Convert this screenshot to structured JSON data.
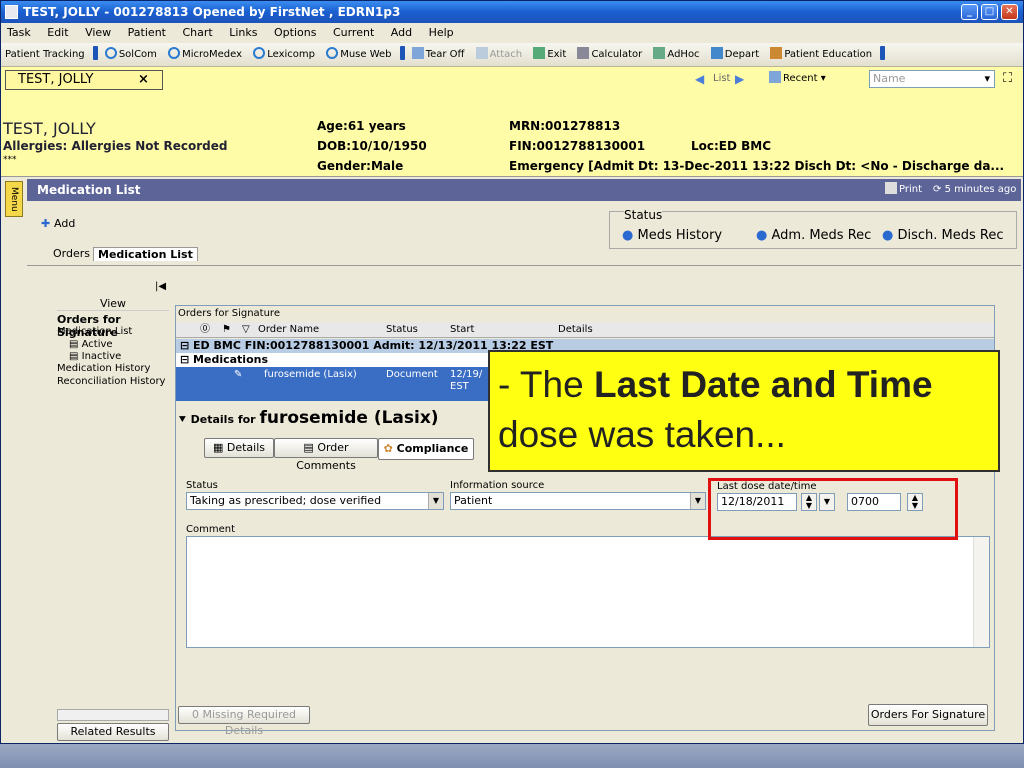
{
  "window": {
    "title": "TEST, JOLLY - 001278813 Opened by FirstNet , EDRN1p3"
  },
  "menu": [
    "Task",
    "Edit",
    "View",
    "Patient",
    "Chart",
    "Links",
    "Options",
    "Current",
    "Add",
    "Help"
  ],
  "toolbar": [
    "Patient Tracking",
    "SolCom",
    "MicroMedex",
    "Lexicomp",
    "Muse Web",
    "Tear Off",
    "Attach",
    "Exit",
    "Calculator",
    "AdHoc",
    "Depart",
    "Patient Education"
  ],
  "patient_tab": {
    "label": "TEST, JOLLY",
    "close": "×"
  },
  "nav": {
    "list": "List",
    "recent": "Recent",
    "name_placeholder": "Name"
  },
  "demographics": {
    "name": "TEST, JOLLY",
    "allergies": "Allergies: Allergies Not Recorded",
    "stars": "***",
    "age": "Age:61 years",
    "dob": "DOB:10/10/1950",
    "gender": "Gender:Male",
    "mrn": "MRN:001278813",
    "fin": "FIN:0012788130001",
    "loc": "Loc:ED BMC",
    "encounter": "Emergency  [Admit Dt: 13-Dec-2011 13:22  Disch Dt: <No - Discharge da..."
  },
  "section": {
    "title": "Medication List",
    "print": "Print",
    "refreshed": "5 minutes ago",
    "menu_tab": "Menu"
  },
  "status_box": {
    "label": "Status",
    "items": [
      "Meds History",
      "Adm. Meds Rec",
      "Disch. Meds Rec"
    ]
  },
  "add_label": "Add",
  "tabs": [
    "Orders",
    "Medication List"
  ],
  "view_panel": {
    "header": "View",
    "items": [
      "Orders for Signature",
      "Medication List",
      "Active",
      "Inactive",
      "Medication History",
      "Reconciliation History"
    ],
    "related": "Related Results"
  },
  "orders": {
    "caption": "Orders for Signature",
    "columns": [
      "Order Name",
      "Status",
      "Start",
      "Details"
    ],
    "group": "ED BMC  FIN:0012788130001  Admit: 12/13/2011 13:22 EST",
    "subgroup": "Medications",
    "row": {
      "name": "furosemide (Lasix)",
      "status": "Document",
      "start": "12/19/",
      "start2": "EST"
    }
  },
  "details": {
    "prefix": "Details for",
    "drug": "furosemide (Lasix)",
    "tabs": [
      "Details",
      "Order Comments",
      "Compliance"
    ]
  },
  "form": {
    "status_label": "Status",
    "status_value": "Taking as prescribed; dose verified",
    "source_label": "Information source",
    "source_value": "Patient",
    "last_dose_label": "Last dose date/time",
    "date": "12/18/2011",
    "time": "0700",
    "comment_label": "Comment"
  },
  "footer": {
    "missing": "0 Missing Required Details",
    "sign": "Orders For Signature"
  },
  "callout": {
    "lead": "- The ",
    "bold": "Last Date and Time",
    "tail": " dose was taken..."
  }
}
